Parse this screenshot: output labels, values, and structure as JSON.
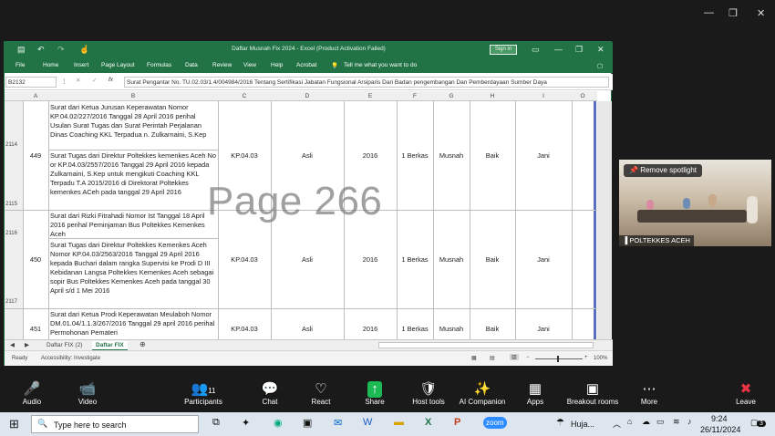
{
  "excel": {
    "title": "Daftar Musnah Fix 2024  -  Excel (Product Activation Failed)",
    "signin": "Sign in",
    "menu": [
      "File",
      "Home",
      "Insert",
      "Page Layout",
      "Formulas",
      "Data",
      "Review",
      "View",
      "Help",
      "Acrobat"
    ],
    "tellme": "Tell me what you want to do",
    "namebox": "B2132",
    "formula": "Surat Pengantar No. TU.02.03/1.4/004984/2016 Tentang Sertifikasi Jabatan Fungsional Arsiparis Dari Badan pengembangan Dan Pemberdayaan Sumber Daya",
    "columns": [
      "A",
      "B",
      "C",
      "D",
      "E",
      "F",
      "G",
      "H",
      "I",
      "O"
    ],
    "rows": [
      {
        "rownum": "2114",
        "no": "449",
        "desc": "Surat dari Ketua Jurusan Keperawatan Nomor KP.04.02/227/2016 Tanggal 28 April 2016 perihal Usulan Surat Tugas dan Surat Perintah Perjalanan Dinas Coaching KKL Terpadua n. Zulkarnaini, S.Kep",
        "code": "KP.04.03",
        "asli": "Asli",
        "year": "2016",
        "qty": "1 Berkas",
        "ket": "Musnah",
        "cond": "Baik",
        "month": "Jani"
      },
      {
        "rownum": "2115",
        "desc": "Surat Tugas dari Direktur Poltekkes kemenkes Aceh No or KP.04.03/2557/2016 Tanggal 29 April 2016 kepada Zulkarnaini, S.Kep untuk mengikuti Coaching KKL Terpadu T.A 2015/2016 di Direktorat Poltekkes kemenkes ACeh pada tanggal 29 April 2016"
      },
      {
        "rownum": "2116",
        "no": "450",
        "desc": "Surat dari Rizki Fitrahadi Nomor Ist Tanggal 18 April 2016 perihal Peminjaman Bus Poltekkes Kemenkes Aceh",
        "code": "KP.04.03",
        "asli": "Asli",
        "year": "2016",
        "qty": "1 Berkas",
        "ket": "Musnah",
        "cond": "Baik",
        "month": "Jani"
      },
      {
        "rownum": "2117",
        "desc": "Surat Tugas dari Direktur Poltekkes Kemenkes Aceh Nomor KP.04.03/2563/2016 Tanggal 29 April 2016 kepada Buchari dalam rangka Supervisi ke Prodi D III Kebidanan Langsa Poltekkes Kemenkes Aceh sebagai sopir Bus Poltekkes Kemenkes Aceh pada tanggal 30 April s/d 1 Mei 2016"
      },
      {
        "no": "451",
        "desc": "Surat dari Ketua Prodi Keperawatan Meulaboh Nomor DM.01.04/1.1.3/267/2016 Tanggal 29 april 2016 perihal Permohonan Pemateri",
        "code": "KP.04.03",
        "asli": "Asli",
        "year": "2016",
        "qty": "1 Berkas",
        "ket": "Musnah",
        "cond": "Baik",
        "month": "Jani"
      }
    ],
    "watermark": "Page 266",
    "sheets": [
      "Daftar FIX (2)",
      "Daftar FIX"
    ],
    "status_ready": "Ready",
    "accessibility": "Accessibility: Investigate",
    "zoom": "100%"
  },
  "spotlight": {
    "button": "Remove spotlight",
    "name": "POLTEKKES ACEH"
  },
  "zoom": {
    "items": [
      {
        "label": "Audio",
        "icon": "🎤"
      },
      {
        "label": "Video",
        "icon": "📹"
      },
      {
        "label": "Participants",
        "icon": "👥",
        "count": "11"
      },
      {
        "label": "Chat",
        "icon": "💬"
      },
      {
        "label": "React",
        "icon": "♡"
      },
      {
        "label": "Share",
        "icon": "↑"
      },
      {
        "label": "Host tools",
        "icon": "🛡"
      },
      {
        "label": "AI Companion",
        "icon": "✨"
      },
      {
        "label": "Apps",
        "icon": "▦"
      },
      {
        "label": "Breakout rooms",
        "icon": "▣"
      },
      {
        "label": "More",
        "icon": "⋯"
      },
      {
        "label": "Leave",
        "icon": "✖"
      }
    ]
  },
  "taskbar": {
    "search": "Type here to search",
    "weather": "Huja...",
    "time": "9:24",
    "date": "26/11/2024",
    "badge": "3"
  }
}
